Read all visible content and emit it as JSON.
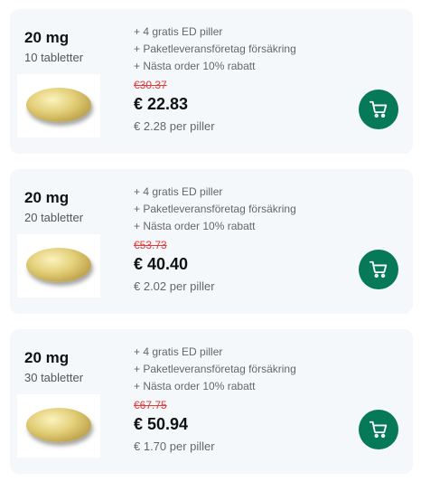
{
  "products": [
    {
      "dose": "20 mg",
      "quantity": "10 tabletter",
      "benefits": [
        "4 gratis ED piller",
        "Paketleveransföretag försäkring",
        "Nästa order 10% rabatt"
      ],
      "old_price": "€30.37",
      "price": "€ 22.83",
      "unit_price": "€ 2.28 per piller",
      "icons": {
        "cart": "shopping-cart-icon"
      }
    },
    {
      "dose": "20 mg",
      "quantity": "20 tabletter",
      "benefits": [
        "4 gratis ED piller",
        "Paketleveransföretag försäkring",
        "Nästa order 10% rabatt"
      ],
      "old_price": "€53.73",
      "price": "€ 40.40",
      "unit_price": "€ 2.02 per piller",
      "icons": {
        "cart": "shopping-cart-icon"
      }
    },
    {
      "dose": "20 mg",
      "quantity": "30 tabletter",
      "benefits": [
        "4 gratis ED piller",
        "Paketleveransföretag försäkring",
        "Nästa order 10% rabatt"
      ],
      "old_price": "€67.75",
      "price": "€ 50.94",
      "unit_price": "€ 1.70 per piller",
      "icons": {
        "cart": "shopping-cart-icon"
      }
    }
  ],
  "colors": {
    "card_background": "#f5f8fb",
    "accent_green": "#067a58",
    "old_price_red": "#e03c3c",
    "pill_gold": "#d9c26a"
  }
}
